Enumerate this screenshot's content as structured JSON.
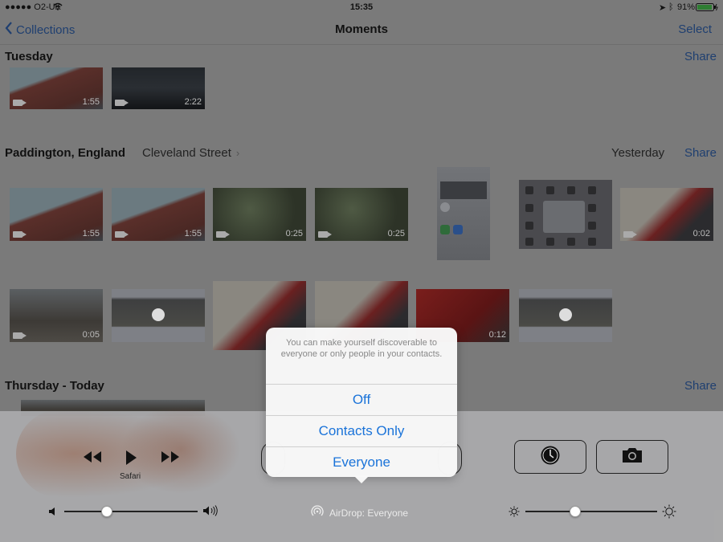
{
  "status_bar": {
    "carrier": "●●●●● O2-UK",
    "time": "15:35",
    "battery": "91%"
  },
  "nav": {
    "back_label": "Collections",
    "title": "Moments",
    "select_label": "Select"
  },
  "sections": [
    {
      "title": "Tuesday",
      "share": "Share",
      "durations": [
        "1:55",
        "2:22"
      ]
    },
    {
      "title": "Paddington, England",
      "subtitle": "Cleveland Street",
      "date": "Yesterday",
      "share": "Share",
      "row1_durations": [
        "1:55",
        "1:55",
        "0:25",
        "0:25",
        "",
        "",
        "0:02"
      ],
      "row2_durations": [
        "0:05",
        "",
        "",
        "",
        "0:12",
        ""
      ]
    },
    {
      "title": "Thursday - Today",
      "share": "Share"
    }
  ],
  "control_center": {
    "now_playing_app": "Safari",
    "airdrop_status": "AirDrop: Everyone",
    "volume_level": 0.32,
    "brightness_level": 0.38,
    "icons": [
      "rewind-icon",
      "play-icon",
      "fast-forward-icon",
      "timer-icon",
      "camera-icon",
      "airdrop-icon",
      "sun-icon",
      "volume-icon"
    ]
  },
  "airdrop_sheet": {
    "message": "You can make yourself discoverable to everyone or only people in your contacts.",
    "options": [
      "Off",
      "Contacts Only",
      "Everyone"
    ],
    "accent_color": "#1a73d9"
  }
}
